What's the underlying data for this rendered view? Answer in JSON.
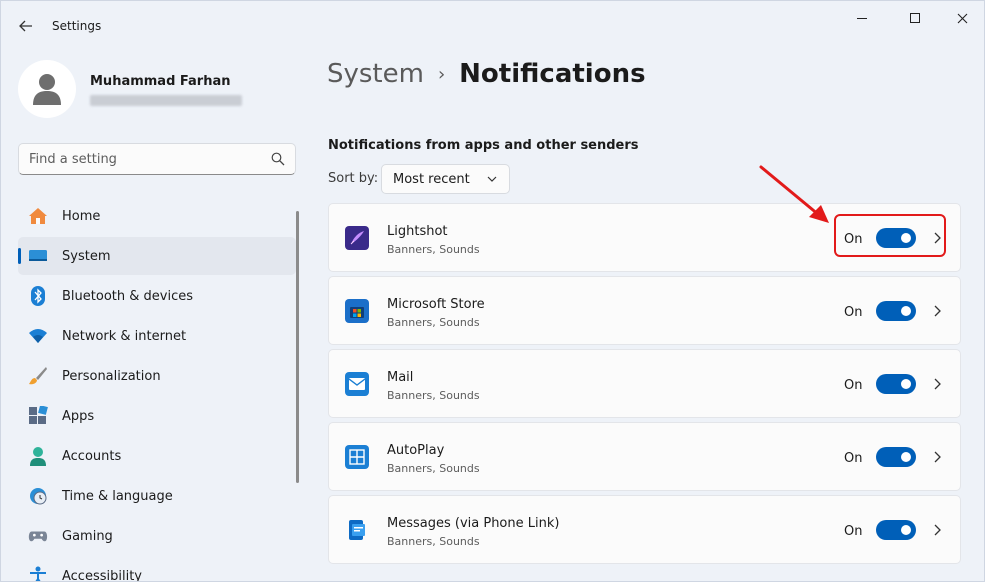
{
  "window": {
    "title": "Settings"
  },
  "profile": {
    "name": "Muhammad Farhan"
  },
  "search": {
    "placeholder": "Find a setting"
  },
  "nav": {
    "items": [
      {
        "label": "Home",
        "icon": "home-icon"
      },
      {
        "label": "System",
        "icon": "system-icon",
        "active": true
      },
      {
        "label": "Bluetooth & devices",
        "icon": "bluetooth-icon"
      },
      {
        "label": "Network & internet",
        "icon": "wifi-icon"
      },
      {
        "label": "Personalization",
        "icon": "brush-icon"
      },
      {
        "label": "Apps",
        "icon": "apps-icon"
      },
      {
        "label": "Accounts",
        "icon": "accounts-icon"
      },
      {
        "label": "Time & language",
        "icon": "clock-globe-icon"
      },
      {
        "label": "Gaming",
        "icon": "gamepad-icon"
      },
      {
        "label": "Accessibility",
        "icon": "accessibility-icon"
      }
    ]
  },
  "breadcrumb": {
    "parent": "System",
    "separator": "›",
    "current": "Notifications"
  },
  "section": {
    "title": "Notifications from apps and other senders"
  },
  "sort": {
    "label": "Sort by:",
    "value": "Most recent"
  },
  "apps": [
    {
      "name": "Lightshot",
      "subtitle": "Banners, Sounds",
      "state": "On",
      "enabled": true,
      "icon": "lightshot-icon"
    },
    {
      "name": "Microsoft Store",
      "subtitle": "Banners, Sounds",
      "state": "On",
      "enabled": true,
      "icon": "microsoft-store-icon"
    },
    {
      "name": "Mail",
      "subtitle": "Banners, Sounds",
      "state": "On",
      "enabled": true,
      "icon": "mail-icon"
    },
    {
      "name": "AutoPlay",
      "subtitle": "Banners, Sounds",
      "state": "On",
      "enabled": true,
      "icon": "autoplay-icon"
    },
    {
      "name": "Messages (via Phone Link)",
      "subtitle": "Banners, Sounds",
      "state": "On",
      "enabled": true,
      "icon": "phone-link-icon"
    }
  ],
  "colors": {
    "accent": "#005fb8",
    "annotation": "#e21a1a"
  }
}
